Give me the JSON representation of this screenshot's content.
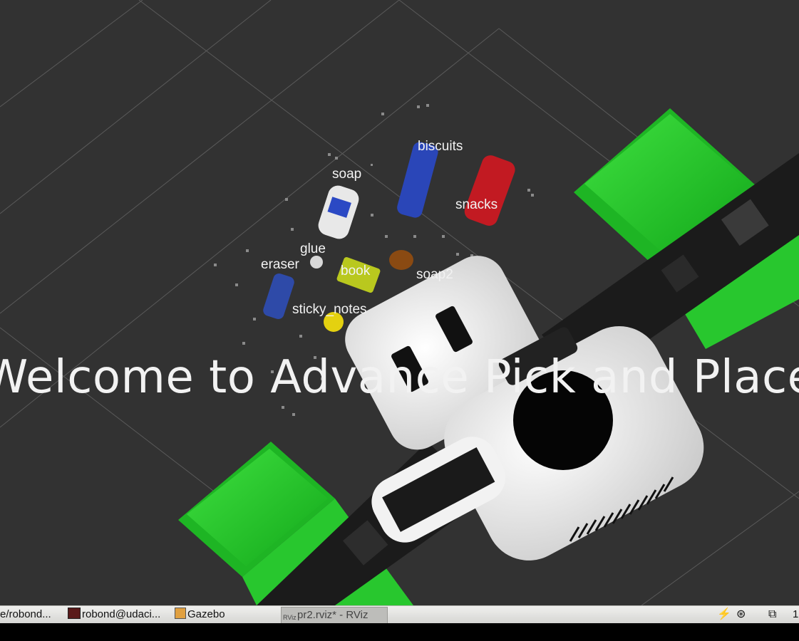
{
  "scene": {
    "object_labels": {
      "biscuits": "biscuits",
      "soap": "soap",
      "snacks": "snacks",
      "glue": "glue",
      "eraser": "eraser",
      "book": "book",
      "soap2": "soap2",
      "sticky_notes": "sticky_notes"
    },
    "welcome_text": "Welcome to Advance Pick and Place",
    "colors": {
      "background": "#323232",
      "bins": "#22c22a",
      "robot": "#eeeeee"
    }
  },
  "taskbar": {
    "items": [
      {
        "label": "e/robond...",
        "icon": "terminal-icon"
      },
      {
        "label": "robond@udaci...",
        "icon": "terminal-icon"
      },
      {
        "label": "Gazebo",
        "icon": "gazebo-icon"
      },
      {
        "label": "pr2.rviz* - RViz",
        "icon": "rviz-icon",
        "active": true
      }
    ],
    "tray": {
      "clock_partial": "1"
    }
  }
}
